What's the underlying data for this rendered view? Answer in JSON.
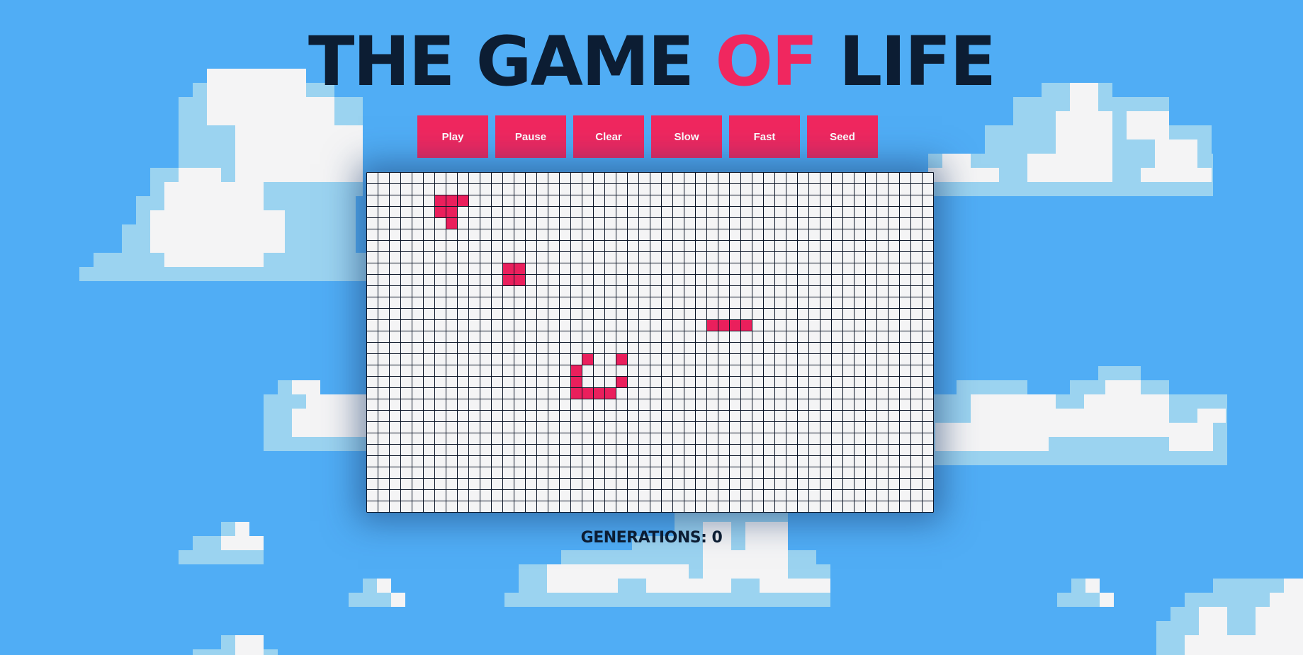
{
  "title": {
    "part1": "THE GAME ",
    "part2": "OF",
    "part3": " LIFE",
    "text_color": "#0c1d33",
    "accent_color": "#f0275f"
  },
  "controls": [
    {
      "id": "play",
      "label": "Play"
    },
    {
      "id": "pause",
      "label": "Pause"
    },
    {
      "id": "clear",
      "label": "Clear"
    },
    {
      "id": "slow",
      "label": "Slow"
    },
    {
      "id": "fast",
      "label": "Fast"
    },
    {
      "id": "seed",
      "label": "Seed"
    }
  ],
  "board": {
    "columns": 50,
    "rows": 30,
    "live_color": "#ea1f5c",
    "dead_color": "#f4f4f5",
    "grid_line_color": "#0a1426",
    "live_cells": [
      [
        6,
        2
      ],
      [
        7,
        2
      ],
      [
        8,
        2
      ],
      [
        6,
        3
      ],
      [
        7,
        3
      ],
      [
        7,
        4
      ],
      [
        12,
        8
      ],
      [
        13,
        8
      ],
      [
        12,
        9
      ],
      [
        13,
        9
      ],
      [
        30,
        13
      ],
      [
        31,
        13
      ],
      [
        32,
        13
      ],
      [
        33,
        13
      ],
      [
        19,
        16
      ],
      [
        22,
        16
      ],
      [
        18,
        17
      ],
      [
        18,
        18
      ],
      [
        22,
        18
      ],
      [
        18,
        19
      ],
      [
        19,
        19
      ],
      [
        20,
        19
      ],
      [
        21,
        19
      ]
    ]
  },
  "generations": {
    "label": "GENERATIONS:",
    "value": "0"
  },
  "colors": {
    "sky": "#50adf5",
    "cloud_light": "#f4f4f5",
    "cloud_shade": "#9bd3f0",
    "button": "#f0275f",
    "button_text": "#ffffff"
  }
}
